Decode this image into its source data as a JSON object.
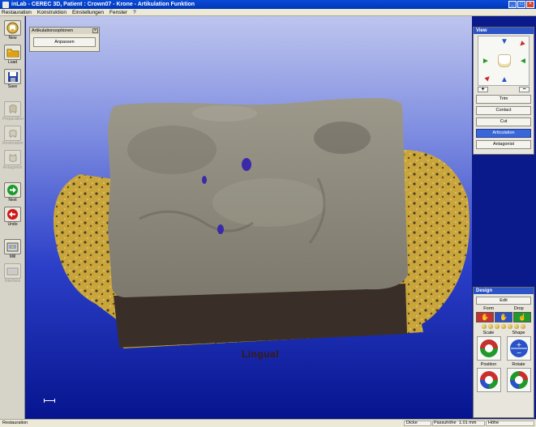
{
  "window": {
    "title": "inLab - CEREC 3D, Patient : Crown07 - Krone - Artikulation Funktion"
  },
  "menu": [
    "Restauration",
    "Konstruktion",
    "Einstellungen",
    "Fenster",
    "?"
  ],
  "toolbar": [
    {
      "label": "New",
      "icon": "new-tooth-icon",
      "enabled": true
    },
    {
      "label": "Load",
      "icon": "folder-icon",
      "enabled": true
    },
    {
      "label": "Save",
      "icon": "disk-icon",
      "enabled": true
    },
    {
      "label": "Preparation",
      "icon": "preparation-icon",
      "enabled": false
    },
    {
      "label": "Restoration",
      "icon": "restoration-icon",
      "enabled": false
    },
    {
      "label": "Antagonist",
      "icon": "antagonist-icon",
      "enabled": false
    },
    {
      "label": "Next",
      "icon": "next-arrow-icon",
      "enabled": true
    },
    {
      "label": "Undo",
      "icon": "undo-arrow-icon",
      "enabled": true
    },
    {
      "label": "Mill",
      "icon": "mill-icon",
      "enabled": true
    },
    {
      "label": "Interface",
      "icon": "interface-icon",
      "enabled": false
    }
  ],
  "dialog": {
    "title": "Artikulationsoptionen",
    "button": "Anpassen"
  },
  "viewport": {
    "orientation_label": "Lingual"
  },
  "view_panel": {
    "title": "View",
    "zoom_in": "+",
    "zoom_out": "−",
    "buttons": [
      "Trim",
      "Contact",
      "Cut",
      "Articulation",
      "Antagonist"
    ],
    "active": "Articulation"
  },
  "design_panel": {
    "title": "Design",
    "edit": "Edit",
    "tool_labels": [
      "Form",
      "Drop"
    ],
    "tools": [
      "Scale",
      "Shape",
      "Position",
      "Rotate"
    ]
  },
  "statusbar": {
    "left": "Restauration",
    "field1": "Dicke",
    "field2_label": "Passuhöhe",
    "field2_value": "1.01 mm",
    "field3": "Höhe"
  },
  "colors": {
    "title_bar": "#0a4bd8",
    "accent": "#2c54c6",
    "viewport_bottom": "#06148e",
    "stone": "#8a877a",
    "gold": "#c8a73e"
  }
}
